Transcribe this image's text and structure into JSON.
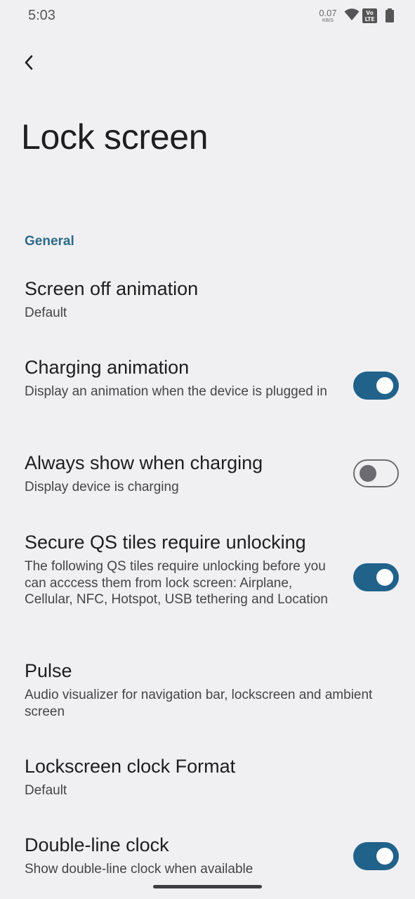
{
  "status_bar": {
    "time": "5:03",
    "net_speed_value": "0.07",
    "net_speed_unit": "KB/S",
    "icons": [
      "wifi-icon",
      "volte-lte-icon",
      "battery-icon"
    ]
  },
  "header": {
    "back_icon": "chevron-left-icon",
    "title": "Lock screen"
  },
  "section": {
    "label": "General"
  },
  "settings": [
    {
      "title": "Screen off animation",
      "summary": "Default"
    },
    {
      "title": "Charging animation",
      "summary": "Display an animation when the device is plugged in",
      "toggle": true
    },
    {
      "title": "Always show when charging",
      "summary": "Display device is charging",
      "toggle": false
    },
    {
      "title": "Secure QS tiles require unlocking",
      "summary": "The following QS tiles require unlocking before you can acccess them from lock screen: Airplane, Cellular, NFC, Hotspot, USB tethering and Location",
      "toggle": true
    },
    {
      "title": "Pulse",
      "summary": "Audio visualizer for navigation bar, lockscreen and ambient screen"
    },
    {
      "title": "Lockscreen clock Format",
      "summary": "Default"
    },
    {
      "title": "Double-line clock",
      "summary": "Show double-line clock when available",
      "toggle": true
    }
  ],
  "colors": {
    "accent": "#20628a",
    "section_header": "#2e6a8a",
    "background": "#f0f0f3"
  }
}
